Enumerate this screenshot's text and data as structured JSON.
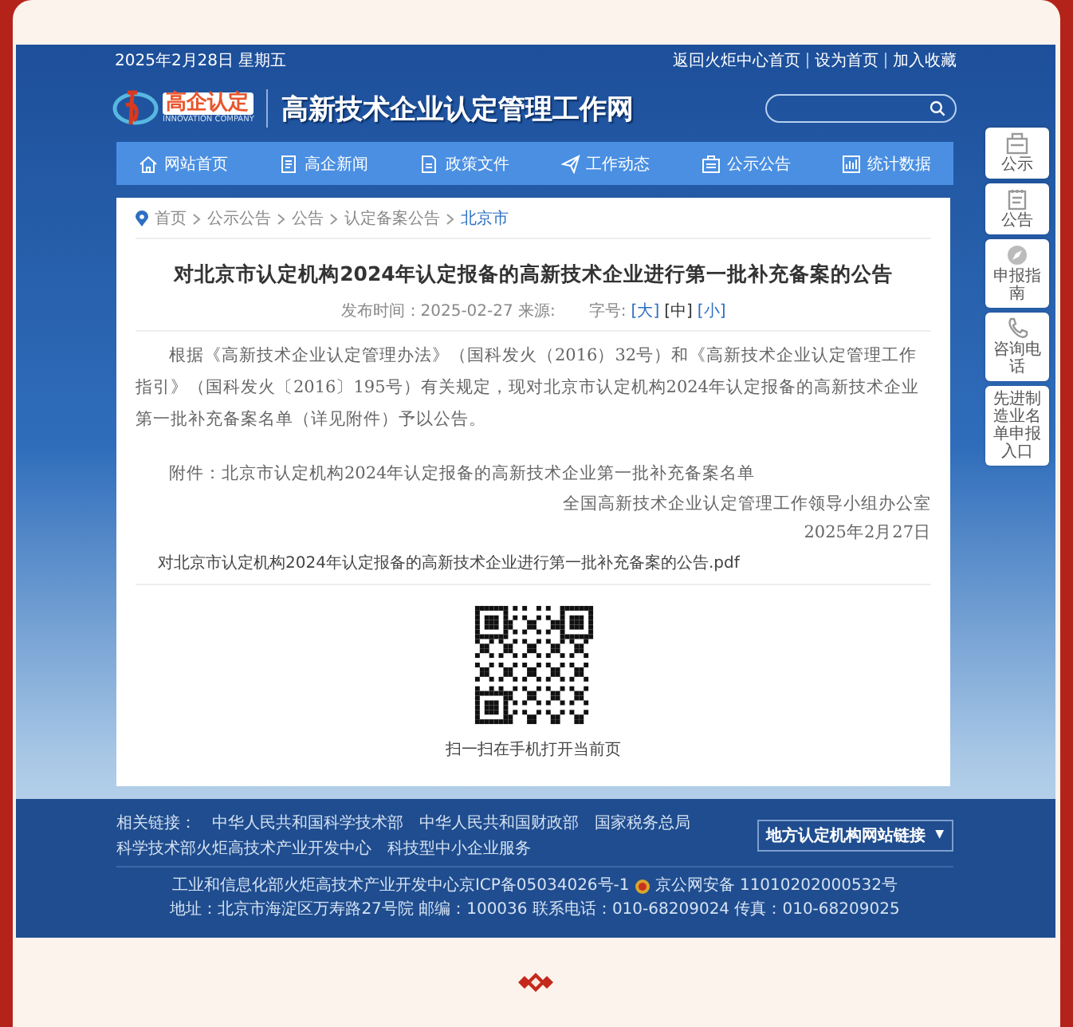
{
  "top_bar": {
    "date": "2025年2月28日 星期五",
    "links": [
      "返回火炬中心首页",
      "设为首页",
      "加入收藏"
    ]
  },
  "header": {
    "logo_text": "高企认定",
    "logo_subtext": "INNOVATION COMPANY",
    "site_title": "高新技术企业认定管理工作网"
  },
  "nav": [
    {
      "label": "网站首页",
      "kind": "home"
    },
    {
      "label": "高企新闻",
      "kind": "news"
    },
    {
      "label": "政策文件",
      "kind": "doc"
    },
    {
      "label": "工作动态",
      "kind": "plane"
    },
    {
      "label": "公示公告",
      "kind": "board"
    },
    {
      "label": "统计数据",
      "kind": "chart"
    }
  ],
  "breadcrumb": [
    "首页",
    "公示公告",
    "公告",
    "认定备案公告",
    "北京市"
  ],
  "article": {
    "title": "对北京市认定机构2024年认定报备的高新技术企业进行第一批补充备案的公告",
    "meta": "发布时间：2025-02-27 来源:",
    "font_size_label": "字号:",
    "font_sizes": [
      {
        "label": "[大]",
        "selected": false
      },
      {
        "label": "[中]",
        "selected": true
      },
      {
        "label": "[小]",
        "selected": false
      }
    ],
    "paragraphs": [
      "根据《高新技术企业认定管理办法》（国科发火（2016）32号）和《高新技术企业认定管理工作指引》（国科发火〔2016〕195号）有关规定，现对北京市认定机构2024年认定报备的高新技术企业第一批补充备案名单（详见附件）予以公告。"
    ],
    "attachment": "附件：北京市认定机构2024年认定报备的高新技术企业第一批补充备案名单",
    "signature": [
      "全国高新技术企业认定管理工作领导小组办公室",
      "2025年2月27日"
    ],
    "file_link": "对北京市认定机构2024年认定报备的高新技术企业进行第一批补充备案的公告.pdf",
    "qr_caption": "扫一扫在手机打开当前页"
  },
  "side_buttons": [
    {
      "label": "公示",
      "kind": "board"
    },
    {
      "label": "公告",
      "kind": "notice"
    },
    {
      "label": "申报指南",
      "kind": "compass"
    },
    {
      "label": "咨询电话",
      "kind": "phone"
    },
    {
      "label": "先进制造业名单申报入口",
      "kind": "text"
    }
  ],
  "footer": {
    "links_label": "相关链接：",
    "links": [
      "中华人民共和国科学技术部",
      "中华人民共和国财政部",
      "国家税务总局",
      "科学技术部火炬高技术产业开发中心",
      "科技型中小企业服务"
    ],
    "dropdown": "地方认定机构网站链接",
    "dropdown_arrow": "▼",
    "icp": "工业和信息化部火炬高技术产业开发中心京ICP备05034026号-1",
    "police": "京公网安备 11010202000532号",
    "address": "地址：北京市海淀区万寿路27号院 邮编：100036 联系电话：010-68209024 传真：010-68209025"
  }
}
